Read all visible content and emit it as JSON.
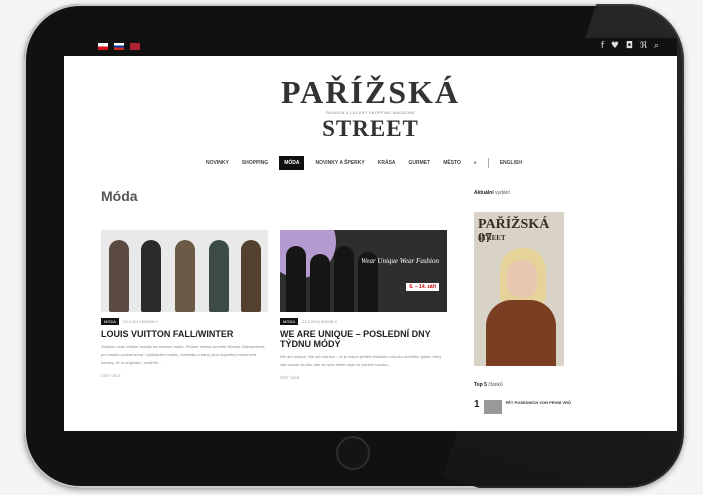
{
  "languages": [
    "cz",
    "ru",
    "uk"
  ],
  "social_icons": "f ♥ ◘ ℜ ⌕",
  "site": {
    "logo_line1": "PAŘÍŽSKÁ",
    "logo_line2": "STREET",
    "tagline": "FASHION & LUXURY SHOPPING MAGAZINE"
  },
  "nav": {
    "items": [
      "NOVINKY",
      "SHOPPING",
      "MÓDA",
      "NOVINKY A ŠPERKY",
      "KRÁSA",
      "GURMET",
      "MĚSTO"
    ],
    "active_index": 2,
    "search_icon": "⌕",
    "lang_label": "ENGLISH"
  },
  "main": {
    "heading": "Móda",
    "articles": [
      {
        "tag": "MÓDA",
        "meta": "23.3.2014  ADMIN 0",
        "title": "LOUIS VUITTON FALL/WINTER",
        "excerpt": "Značka Louis Vuitton vsadila na sezónní módu. Přesně čtrnáct proměn Nicolas Ghesquièrea pro značku podzimzima. Cyklistické modely, materiály a barvy jsou doplněny moderními kousky. Je to originální, neotřelé...",
        "more": "ČÍST VÍCE"
      },
      {
        "tag": "MÓDA",
        "meta": "23.3.2014  ADMIN 0",
        "title": "WE ARE UNIQUE – POSLEDNÍ DNY TÝDNU MÓDY",
        "excerpt": "We are unique, We are fashion – to je hlavní příběh letošního ročníku módního týdne, který vás vezme do ulic, kde se mísí street style se světem luxusu...",
        "more": "ČÍST VÍCE",
        "promo": "Wear Unique Wear Fashion",
        "dates": "6. – 14. září"
      }
    ]
  },
  "sidebar": {
    "current_label_bold": "Aktuální",
    "current_label_rest": " vydání",
    "mag_title": "PAŘÍŽSKÁ 07",
    "mag_sub": "STREET",
    "top5_bold": "Top 5",
    "top5_rest": " článků",
    "top5_first": "PĚT POSEDNÍCH VOR PRVNÍ VRŮ",
    "top5_num": "1"
  }
}
